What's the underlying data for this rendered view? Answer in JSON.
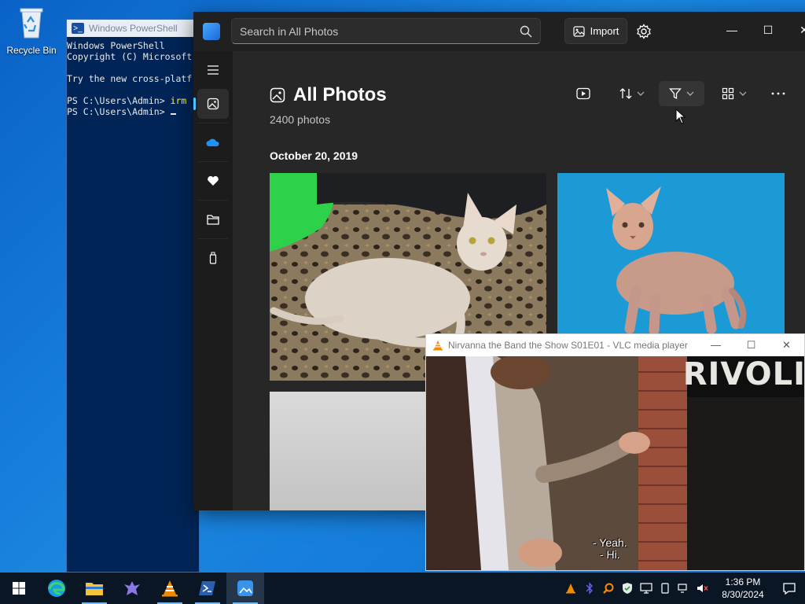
{
  "desktop": {
    "recycle_bin_label": "Recycle Bin"
  },
  "powershell": {
    "title": "Windows PowerShell",
    "lines": [
      "Windows PowerShell",
      "Copyright (C) Microsoft",
      "",
      "Try the new cross-platf",
      ""
    ],
    "prompt1": "PS C:\\Users\\Admin> ",
    "cmd1": "irm",
    "prompt2": "PS C:\\Users\\Admin> "
  },
  "photos": {
    "search_placeholder": "Search in All Photos",
    "import_label": "Import",
    "heading": "All Photos",
    "count": "2400 photos",
    "date_header": "October 20, 2019",
    "accent": "#4cc2ff"
  },
  "vlc": {
    "title": "Nirvanna the Band the Show S01E01 - VLC media player",
    "subtitle": "- Yeah.\n- Hi.",
    "sign_text": "RIVOLI"
  },
  "taskbar": {
    "time": "1:36 PM",
    "date": "8/30/2024"
  }
}
